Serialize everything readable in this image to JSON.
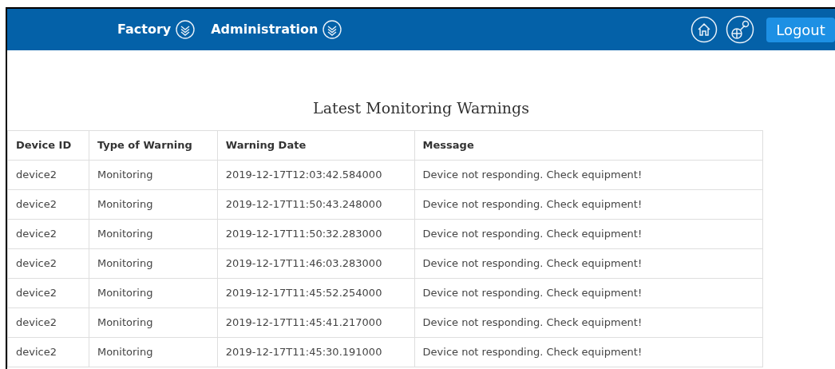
{
  "nav": {
    "menus": [
      {
        "label": "Factory"
      },
      {
        "label": "Administration"
      }
    ],
    "logout": "Logout"
  },
  "title": "Latest Monitoring Warnings",
  "table": {
    "columns": [
      "Device ID",
      "Type of Warning",
      "Warning Date",
      "Message"
    ],
    "rows": [
      [
        "device2",
        "Monitoring",
        "2019-12-17T12:03:42.584000",
        "Device not responding. Check equipment!"
      ],
      [
        "device2",
        "Monitoring",
        "2019-12-17T11:50:43.248000",
        "Device not responding. Check equipment!"
      ],
      [
        "device2",
        "Monitoring",
        "2019-12-17T11:50:32.283000",
        "Device not responding. Check equipment!"
      ],
      [
        "device2",
        "Monitoring",
        "2019-12-17T11:46:03.283000",
        "Device not responding. Check equipment!"
      ],
      [
        "device2",
        "Monitoring",
        "2019-12-17T11:45:52.254000",
        "Device not responding. Check equipment!"
      ],
      [
        "device2",
        "Monitoring",
        "2019-12-17T11:45:41.217000",
        "Device not responding. Check equipment!"
      ],
      [
        "device2",
        "Monitoring",
        "2019-12-17T11:45:30.191000",
        "Device not responding. Check equipment!"
      ]
    ]
  }
}
